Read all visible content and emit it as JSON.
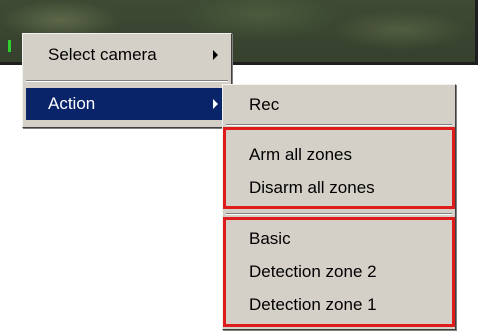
{
  "context_menu": {
    "items": [
      {
        "label": "Select camera",
        "has_submenu": true,
        "highlighted": false
      },
      {
        "label": "Action",
        "has_submenu": true,
        "highlighted": true
      }
    ]
  },
  "action_submenu": {
    "items": [
      {
        "label": "Rec"
      },
      {
        "label": "Arm all zones"
      },
      {
        "label": "Disarm all zones"
      },
      {
        "label": "Basic"
      },
      {
        "label": "Detection zone 2"
      },
      {
        "label": "Detection zone 1"
      }
    ],
    "highlight_box_color": "#e01b1b"
  },
  "colors": {
    "menu_background": "#d4d0c8",
    "selection_background": "#0a246a"
  }
}
